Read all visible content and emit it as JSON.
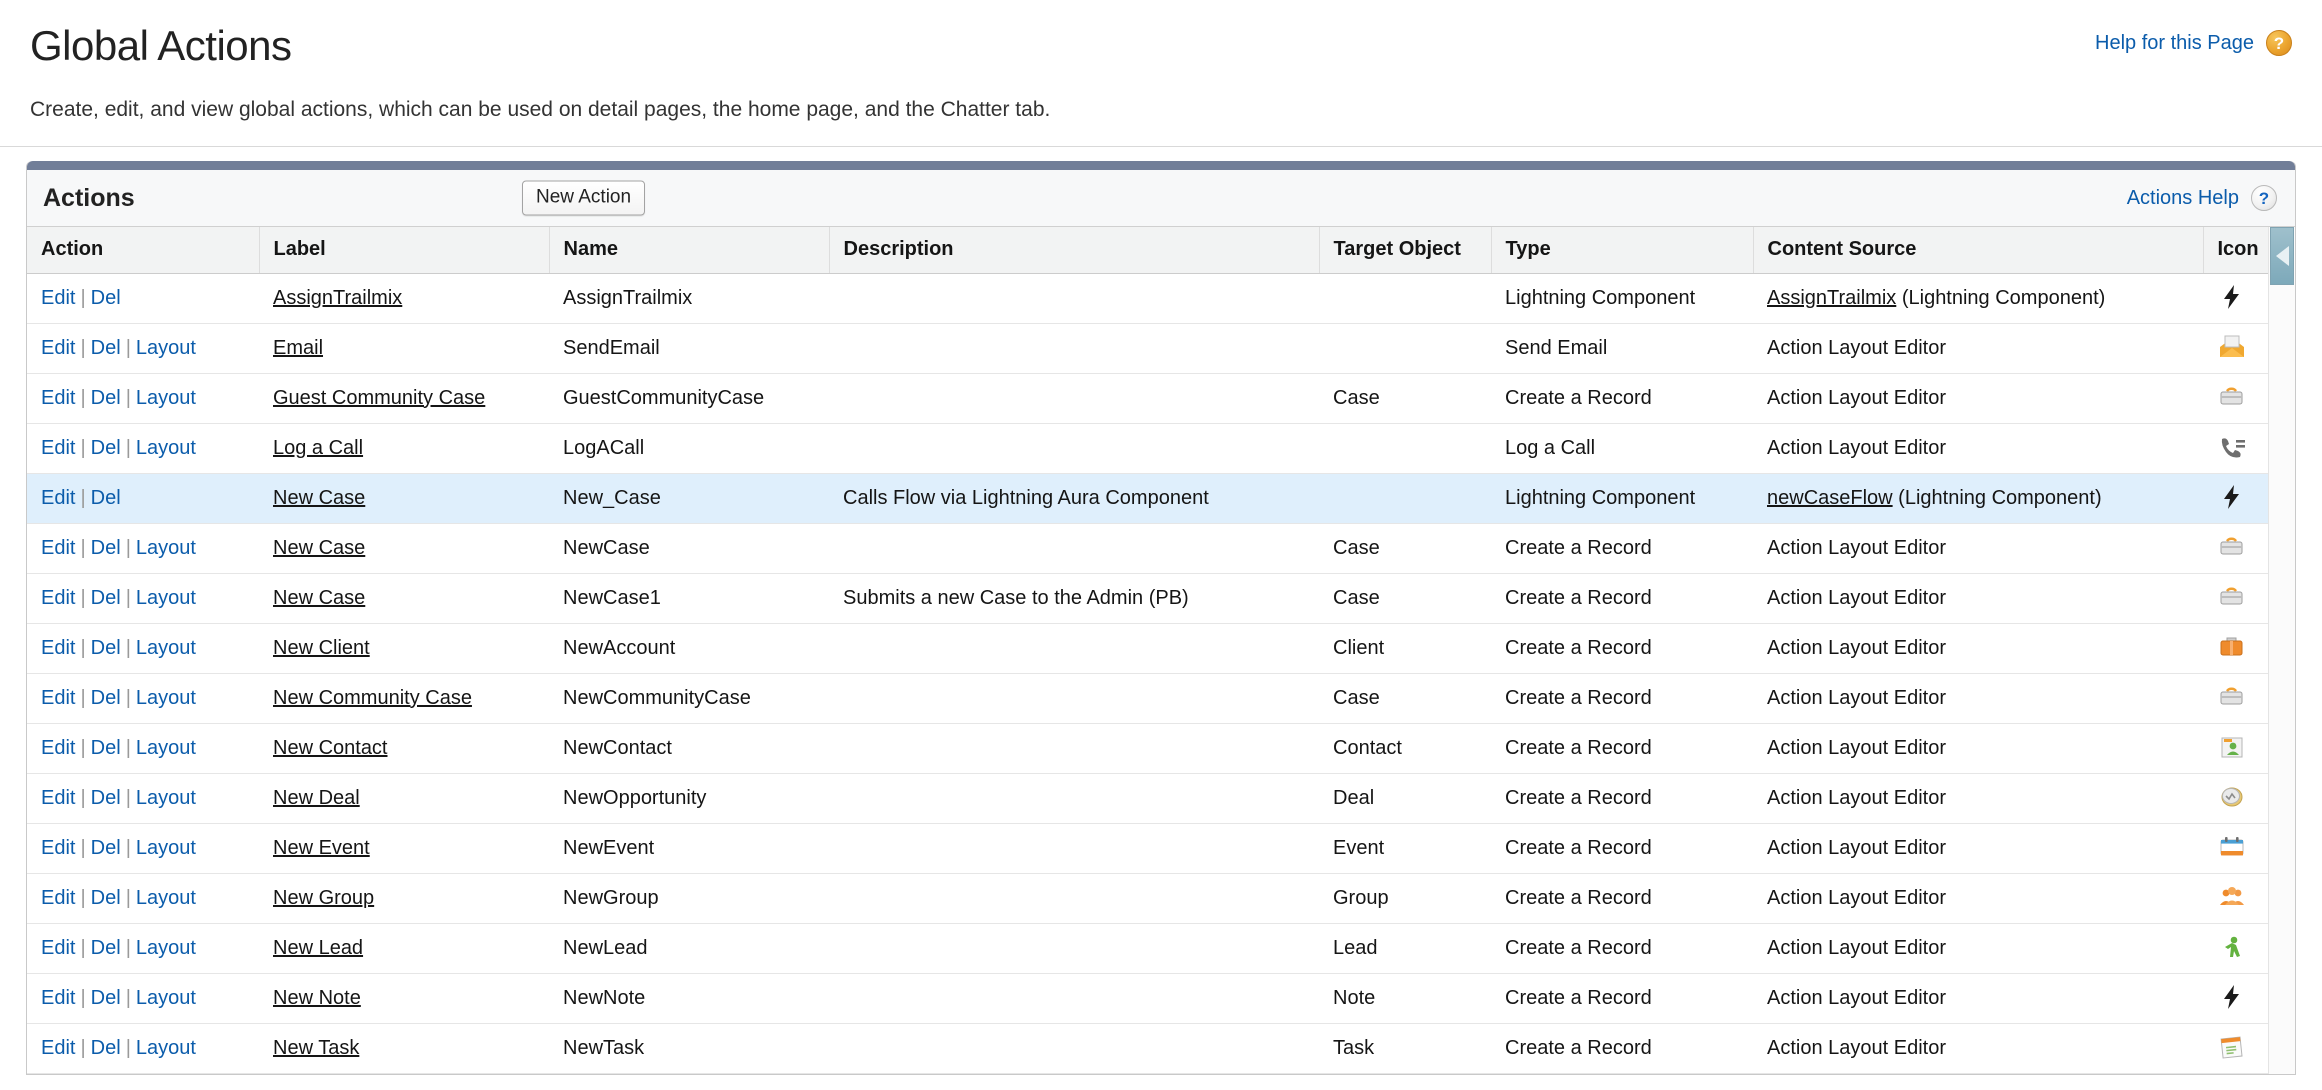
{
  "page": {
    "title": "Global Actions",
    "description": "Create, edit, and view global actions, which can be used on detail pages, the home page, and the Chatter tab.",
    "help_link_label": "Help for this Page",
    "help_icon": "question-mark-orange-icon"
  },
  "panel": {
    "title": "Actions",
    "new_action_label": "New Action",
    "actions_help_label": "Actions Help",
    "actions_help_icon": "question-mark-gray-icon"
  },
  "table": {
    "columns": [
      "Action",
      "Label",
      "Name",
      "Description",
      "Target Object",
      "Type",
      "Content Source",
      "Icon"
    ],
    "action_links": {
      "edit": "Edit",
      "del": "Del",
      "layout": "Layout",
      "separator": "|"
    },
    "rows": [
      {
        "actions": [
          "Edit",
          "Del"
        ],
        "label": "AssignTrailmix",
        "name": "AssignTrailmix",
        "description": "",
        "target_object": "",
        "type": "Lightning Component",
        "source_link": "AssignTrailmix",
        "source_suffix": " (Lightning Component)",
        "icon": "lightning-bolt-icon",
        "highlighted": false
      },
      {
        "actions": [
          "Edit",
          "Del",
          "Layout"
        ],
        "label": "Email",
        "name": "SendEmail",
        "description": "",
        "target_object": "",
        "type": "Send Email",
        "source_link": "",
        "source_suffix": "Action Layout Editor",
        "icon": "open-envelope-icon",
        "highlighted": false
      },
      {
        "actions": [
          "Edit",
          "Del",
          "Layout"
        ],
        "label": "Guest Community Case",
        "name": "GuestCommunityCase",
        "description": "",
        "target_object": "Case",
        "type": "Create a Record",
        "source_link": "",
        "source_suffix": "Action Layout Editor",
        "icon": "case-briefcase-gray-icon",
        "highlighted": false
      },
      {
        "actions": [
          "Edit",
          "Del",
          "Layout"
        ],
        "label": "Log a Call",
        "name": "LogACall",
        "description": "",
        "target_object": "",
        "type": "Log a Call",
        "source_link": "",
        "source_suffix": "Action Layout Editor",
        "icon": "phone-log-icon",
        "highlighted": false
      },
      {
        "actions": [
          "Edit",
          "Del"
        ],
        "label": "New Case",
        "name": "New_Case",
        "description": "Calls Flow via Lightning Aura Component",
        "target_object": "",
        "type": "Lightning Component",
        "source_link": "newCaseFlow",
        "source_suffix": " (Lightning Component)",
        "icon": "lightning-bolt-icon",
        "highlighted": true
      },
      {
        "actions": [
          "Edit",
          "Del",
          "Layout"
        ],
        "label": "New Case",
        "name": "NewCase",
        "description": "",
        "target_object": "Case",
        "type": "Create a Record",
        "source_link": "",
        "source_suffix": "Action Layout Editor",
        "icon": "case-briefcase-gray-icon",
        "highlighted": false
      },
      {
        "actions": [
          "Edit",
          "Del",
          "Layout"
        ],
        "label": "New Case",
        "name": "NewCase1",
        "description": "Submits a new Case to the Admin (PB)",
        "target_object": "Case",
        "type": "Create a Record",
        "source_link": "",
        "source_suffix": "Action Layout Editor",
        "icon": "case-briefcase-gray-icon",
        "highlighted": false
      },
      {
        "actions": [
          "Edit",
          "Del",
          "Layout"
        ],
        "label": "New Client",
        "name": "NewAccount",
        "description": "",
        "target_object": "Client",
        "type": "Create a Record",
        "source_link": "",
        "source_suffix": "Action Layout Editor",
        "icon": "account-briefcase-orange-icon",
        "highlighted": false
      },
      {
        "actions": [
          "Edit",
          "Del",
          "Layout"
        ],
        "label": "New Community Case",
        "name": "NewCommunityCase",
        "description": "",
        "target_object": "Case",
        "type": "Create a Record",
        "source_link": "",
        "source_suffix": "Action Layout Editor",
        "icon": "case-briefcase-gray-icon",
        "highlighted": false
      },
      {
        "actions": [
          "Edit",
          "Del",
          "Layout"
        ],
        "label": "New Contact",
        "name": "NewContact",
        "description": "",
        "target_object": "Contact",
        "type": "Create a Record",
        "source_link": "",
        "source_suffix": "Action Layout Editor",
        "icon": "contact-card-icon",
        "highlighted": false
      },
      {
        "actions": [
          "Edit",
          "Del",
          "Layout"
        ],
        "label": "New Deal",
        "name": "NewOpportunity",
        "description": "",
        "target_object": "Deal",
        "type": "Create a Record",
        "source_link": "",
        "source_suffix": "Action Layout Editor",
        "icon": "opportunity-coin-icon",
        "highlighted": false
      },
      {
        "actions": [
          "Edit",
          "Del",
          "Layout"
        ],
        "label": "New Event",
        "name": "NewEvent",
        "description": "",
        "target_object": "Event",
        "type": "Create a Record",
        "source_link": "",
        "source_suffix": "Action Layout Editor",
        "icon": "calendar-event-icon",
        "highlighted": false
      },
      {
        "actions": [
          "Edit",
          "Del",
          "Layout"
        ],
        "label": "New Group",
        "name": "NewGroup",
        "description": "",
        "target_object": "Group",
        "type": "Create a Record",
        "source_link": "",
        "source_suffix": "Action Layout Editor",
        "icon": "group-people-icon",
        "highlighted": false
      },
      {
        "actions": [
          "Edit",
          "Del",
          "Layout"
        ],
        "label": "New Lead",
        "name": "NewLead",
        "description": "",
        "target_object": "Lead",
        "type": "Create a Record",
        "source_link": "",
        "source_suffix": "Action Layout Editor",
        "icon": "lead-person-green-icon",
        "highlighted": false
      },
      {
        "actions": [
          "Edit",
          "Del",
          "Layout"
        ],
        "label": "New Note",
        "name": "NewNote",
        "description": "",
        "target_object": "Note",
        "type": "Create a Record",
        "source_link": "",
        "source_suffix": "Action Layout Editor",
        "icon": "lightning-bolt-icon",
        "highlighted": false
      },
      {
        "actions": [
          "Edit",
          "Del",
          "Layout"
        ],
        "label": "New Task",
        "name": "NewTask",
        "description": "",
        "target_object": "Task",
        "type": "Create a Record",
        "source_link": "",
        "source_suffix": "Action Layout Editor",
        "icon": "task-notepad-icon",
        "highlighted": false
      }
    ]
  },
  "colors": {
    "link": "#0b5cab",
    "panel_topbar": "#717e98",
    "row_highlight": "#dfeffc",
    "header_bg": "#f2f3f3",
    "scrollbar_thumb": "#7da9ba"
  }
}
